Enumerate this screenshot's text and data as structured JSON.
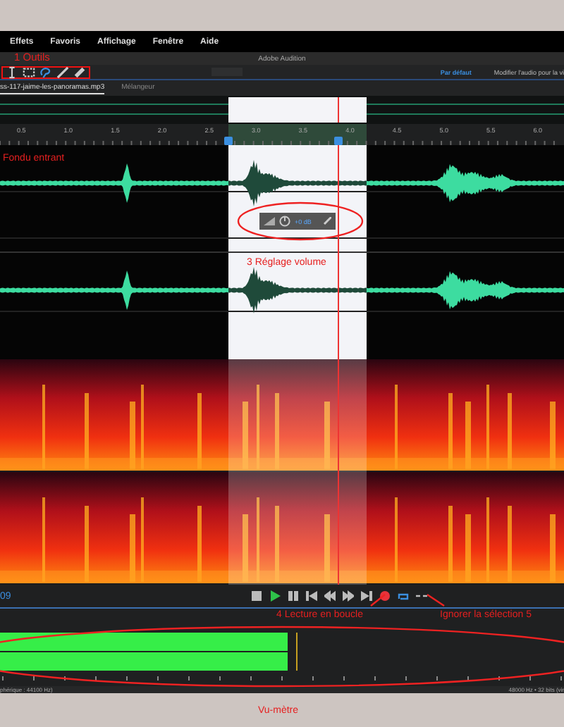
{
  "menu_bar": {
    "items": [
      "Effets",
      "Favoris",
      "Affichage",
      "Fenêtre",
      "Aide"
    ]
  },
  "app_title": "Adobe Audition",
  "toolbar": {
    "tools": [
      {
        "kind": "time",
        "selected": false
      },
      {
        "kind": "marquee",
        "selected": false
      },
      {
        "kind": "lasso",
        "selected": true
      },
      {
        "kind": "brush",
        "selected": false
      },
      {
        "kind": "healing",
        "selected": false
      }
    ],
    "workspace": "Par défaut",
    "workspace_link": "Modifier l'audio pour la vi"
  },
  "tabs": [
    {
      "label": "ss-117-jaime-les-panoramas.mp3",
      "selected": true
    },
    {
      "label": "Mélangeur",
      "selected": false
    }
  ],
  "ruler": {
    "labels": [
      "0.5",
      "1.0",
      "1.5",
      "2.0",
      "2.5",
      "3.0",
      "3.5",
      "4.0",
      "4.5",
      "5.0",
      "5.5",
      "6.0"
    ]
  },
  "volume_hud": {
    "reading": "+0 dB"
  },
  "transport": {
    "time": "09",
    "buttons": [
      {
        "kind": "stop"
      },
      {
        "kind": "play"
      },
      {
        "kind": "pause"
      },
      {
        "kind": "start"
      },
      {
        "kind": "rewind"
      },
      {
        "kind": "forward"
      },
      {
        "kind": "end"
      },
      {
        "kind": "record"
      },
      {
        "kind": "loop",
        "on": true
      },
      {
        "kind": "skip",
        "on": false
      }
    ]
  },
  "meter": {
    "channels": [
      {
        "level": 0.51
      },
      {
        "level": 0.51
      }
    ]
  },
  "status_bar": {
    "left": "phérique : 44100 Hz)",
    "right": "48000 Hz • 32 bits (vir"
  },
  "annotations": [
    {
      "kind": "tools",
      "label": "1  Outils"
    },
    {
      "kind": "fade",
      "label": "Fondu entrant"
    },
    {
      "kind": "volume",
      "label": "3   Réglage volume"
    },
    {
      "kind": "loop",
      "label": "4  Lecture en boucle"
    },
    {
      "kind": "skip",
      "label": "Ignorer la sélection 5"
    },
    {
      "kind": "meter",
      "label": "Vu-mètre"
    }
  ]
}
